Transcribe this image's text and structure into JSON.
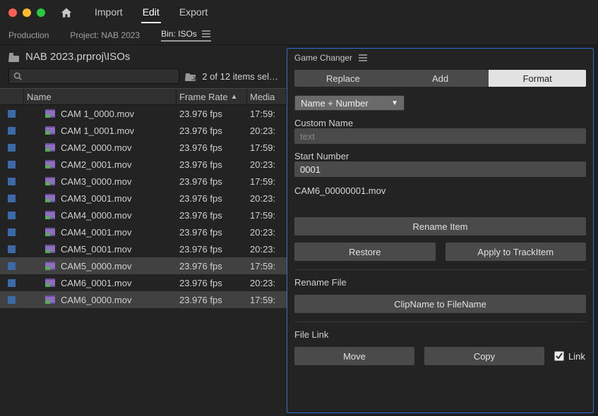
{
  "titlebar": {
    "menus": [
      "Import",
      "Edit",
      "Export"
    ],
    "active_menu_index": 1
  },
  "subbar": {
    "production": "Production",
    "project": "Project: NAB 2023",
    "bin": "Bin: ISOs",
    "active_index": 2
  },
  "project_panel": {
    "path": "NAB 2023.prproj\\ISOs",
    "search_placeholder": "",
    "items_status": "2 of 12 items sel…",
    "columns": {
      "name": "Name",
      "frame_rate": "Frame Rate",
      "media": "Media"
    },
    "rows": [
      {
        "selected": false,
        "name": "CAM 1_0000.mov",
        "frame_rate": "23.976 fps",
        "media": "17:59:"
      },
      {
        "selected": false,
        "name": "CAM 1_0001.mov",
        "frame_rate": "23.976 fps",
        "media": "20:23:"
      },
      {
        "selected": false,
        "name": "CAM2_0000.mov",
        "frame_rate": "23.976 fps",
        "media": "17:59:"
      },
      {
        "selected": false,
        "name": "CAM2_0001.mov",
        "frame_rate": "23.976 fps",
        "media": "20:23:"
      },
      {
        "selected": false,
        "name": "CAM3_0000.mov",
        "frame_rate": "23.976 fps",
        "media": "17:59:"
      },
      {
        "selected": false,
        "name": "CAM3_0001.mov",
        "frame_rate": "23.976 fps",
        "media": "20:23:"
      },
      {
        "selected": false,
        "name": "CAM4_0000.mov",
        "frame_rate": "23.976 fps",
        "media": "17:59:"
      },
      {
        "selected": false,
        "name": "CAM4_0001.mov",
        "frame_rate": "23.976 fps",
        "media": "20:23:"
      },
      {
        "selected": false,
        "name": "CAM5_0001.mov",
        "frame_rate": "23.976 fps",
        "media": "20:23:"
      },
      {
        "selected": true,
        "name": "CAM5_0000.mov",
        "frame_rate": "23.976 fps",
        "media": "17:59:"
      },
      {
        "selected": false,
        "name": "CAM6_0001.mov",
        "frame_rate": "23.976 fps",
        "media": "20:23:"
      },
      {
        "selected": true,
        "name": "CAM6_0000.mov",
        "frame_rate": "23.976 fps",
        "media": "17:59:"
      }
    ]
  },
  "gamechanger": {
    "title": "Game Changer",
    "tabs": [
      "Replace",
      "Add",
      "Format"
    ],
    "active_tab_index": 2,
    "mode_options": [
      "Name + Number"
    ],
    "mode_selected": "Name + Number",
    "custom_name_label": "Custom Name",
    "custom_name_placeholder": "text",
    "custom_name_value": "",
    "start_number_label": "Start Number",
    "start_number_value": "0001",
    "preview": "CAM6_00000001.mov",
    "rename_item": "Rename Item",
    "restore": "Restore",
    "apply_to_trackitem": "Apply to TrackItem",
    "rename_file_label": "Rename File",
    "clipname_to_filename": "ClipName to FileName",
    "file_link_label": "File Link",
    "move": "Move",
    "copy": "Copy",
    "link": "Link",
    "link_checked": true
  }
}
